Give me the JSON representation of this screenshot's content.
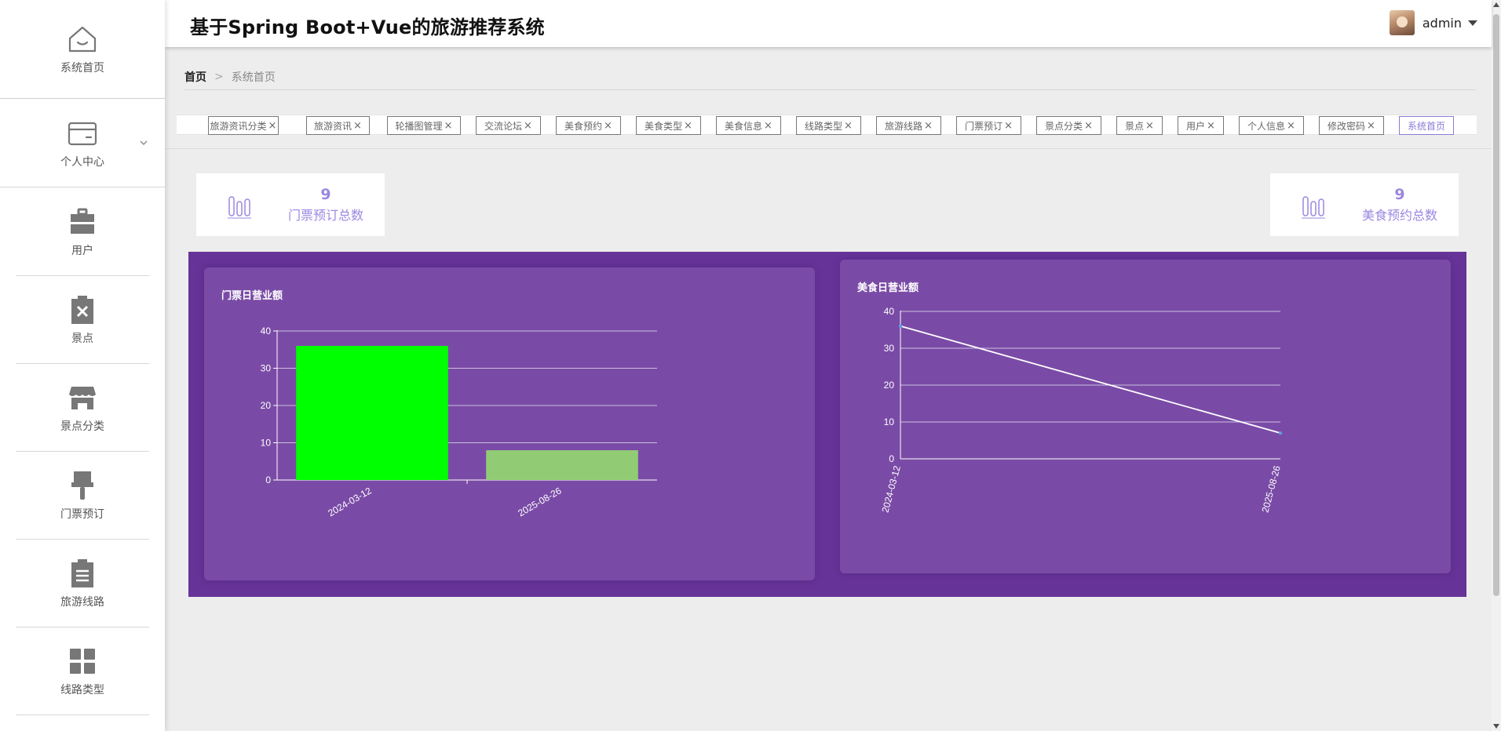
{
  "app": {
    "title": "基于Spring Boot+Vue的旅游推荐系统"
  },
  "user": {
    "name": "admin"
  },
  "sidebar": {
    "home": {
      "label": "系统首页",
      "icon": "home-icon"
    },
    "personal": {
      "label": "个人中心",
      "icon": "wallet-icon"
    },
    "items": [
      {
        "label": "用户",
        "icon": "briefcase-icon"
      },
      {
        "label": "景点",
        "icon": "clipboard-x-icon"
      },
      {
        "label": "景点分类",
        "icon": "shop-icon"
      },
      {
        "label": "门票预订",
        "icon": "brush-icon"
      },
      {
        "label": "旅游线路",
        "icon": "clipboard-list-icon"
      },
      {
        "label": "线路类型",
        "icon": "grid-icon"
      }
    ]
  },
  "breadcrumb": {
    "home": "首页",
    "separator": ">",
    "current": "系统首页"
  },
  "tags": [
    {
      "label": "旅游资讯分类",
      "close": "×"
    },
    {
      "label": "旅游资讯",
      "close": "×"
    },
    {
      "label": "轮播图管理",
      "close": "×"
    },
    {
      "label": "交流论坛",
      "close": "×"
    },
    {
      "label": "美食预约",
      "close": "×"
    },
    {
      "label": "美食类型",
      "close": "×"
    },
    {
      "label": "美食信息",
      "close": "×"
    },
    {
      "label": "线路类型",
      "close": "×"
    },
    {
      "label": "旅游线路",
      "close": "×"
    },
    {
      "label": "门票预订",
      "close": "×"
    },
    {
      "label": "景点分类",
      "close": "×"
    },
    {
      "label": "景点",
      "close": "×"
    },
    {
      "label": "用户",
      "close": "×"
    },
    {
      "label": "个人信息",
      "close": "×"
    },
    {
      "label": "修改密码",
      "close": "×"
    },
    {
      "label": "系统首页",
      "close": ""
    }
  ],
  "stats": {
    "ticket": {
      "value": "9",
      "label": "门票预订总数"
    },
    "food": {
      "value": "9",
      "label": "美食预约总数"
    }
  },
  "colors": {
    "accent": "#9b87e0",
    "charts_bg": "#663399",
    "panel_bg": "#7a4ba6",
    "bar_primary": "#00ff00",
    "bar_secondary": "#91cc75",
    "line": "#ffffff"
  },
  "chart_data": [
    {
      "type": "bar",
      "title": "门票日营业额",
      "categories": [
        "2024-03-12",
        "2025-08-26"
      ],
      "values": [
        36,
        8
      ],
      "ylim": [
        0,
        40
      ],
      "yticks": [
        0,
        10,
        20,
        30,
        40
      ],
      "grid": true
    },
    {
      "type": "line",
      "title": "美食日营业额",
      "categories": [
        "2024-03-12",
        "2025-08-26"
      ],
      "values": [
        36,
        7
      ],
      "ylim": [
        0,
        40
      ],
      "yticks": [
        0,
        10,
        20,
        30,
        40
      ],
      "grid": true
    }
  ]
}
